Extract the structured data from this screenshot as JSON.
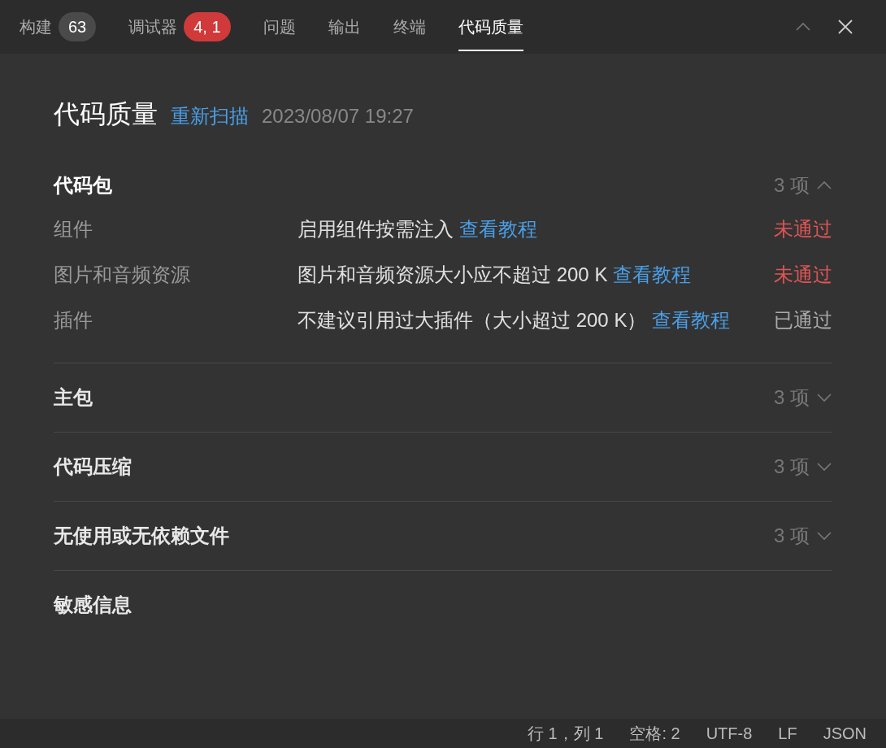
{
  "tabs": [
    {
      "label": "构建",
      "badge": "63",
      "color": "#4a4a4a",
      "selected": false
    },
    {
      "label": "调试器",
      "badge": "4, 1",
      "color": "#d03a3a",
      "selected": false
    },
    {
      "label": "问题",
      "selected": false
    },
    {
      "label": "输出",
      "selected": false
    },
    {
      "label": "终端",
      "selected": false
    },
    {
      "label": "代码质量",
      "selected": true
    }
  ],
  "header": {
    "title": "代码质量",
    "rescan": "重新扫描",
    "timestamp": "2023/08/07 19:27"
  },
  "sections": [
    {
      "title": "代码包",
      "count": "3 项",
      "expanded": true,
      "rows": [
        {
          "name": "组件",
          "description": "启用组件按需注入",
          "link": "查看教程",
          "status": "未通过",
          "passed": false
        },
        {
          "name": "图片和音频资源",
          "description": "图片和音频资源大小应不超过 200 K",
          "link": "查看教程",
          "status": "未通过",
          "passed": false
        },
        {
          "name": "插件",
          "description": "不建议引用过大插件（大小超过 200 K）",
          "link": "查看教程",
          "status": "已通过",
          "passed": true
        }
      ]
    },
    {
      "title": "主包",
      "count": "3 项",
      "expanded": false
    },
    {
      "title": "代码压缩",
      "count": "3 项",
      "expanded": false
    },
    {
      "title": "无使用或无依赖文件",
      "count": "3 项",
      "expanded": false
    },
    {
      "title": "敏感信息",
      "expanded": false
    }
  ],
  "status_bar": [
    "行 1，列 1",
    "空格: 2",
    "UTF-8",
    "LF",
    "JSON"
  ]
}
